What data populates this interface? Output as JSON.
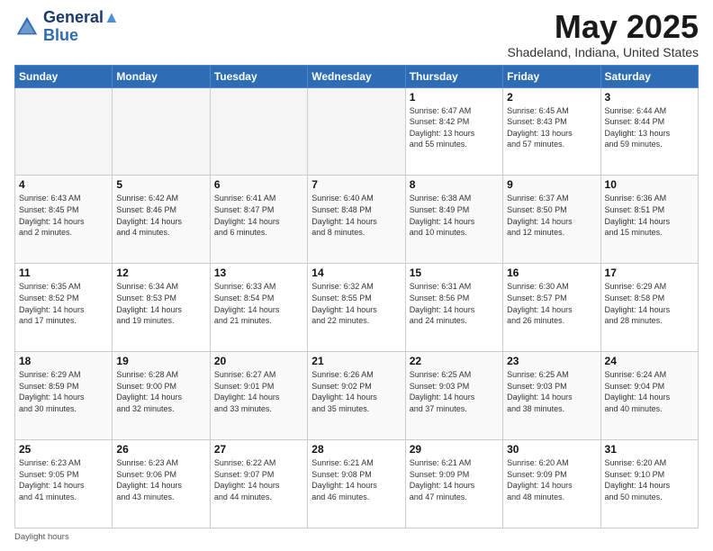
{
  "header": {
    "logo_line1": "General",
    "logo_line2": "Blue",
    "main_title": "May 2025",
    "subtitle": "Shadeland, Indiana, United States"
  },
  "calendar": {
    "headers": [
      "Sunday",
      "Monday",
      "Tuesday",
      "Wednesday",
      "Thursday",
      "Friday",
      "Saturday"
    ],
    "weeks": [
      [
        {
          "day": "",
          "info": ""
        },
        {
          "day": "",
          "info": ""
        },
        {
          "day": "",
          "info": ""
        },
        {
          "day": "",
          "info": ""
        },
        {
          "day": "1",
          "info": "Sunrise: 6:47 AM\nSunset: 8:42 PM\nDaylight: 13 hours\nand 55 minutes."
        },
        {
          "day": "2",
          "info": "Sunrise: 6:45 AM\nSunset: 8:43 PM\nDaylight: 13 hours\nand 57 minutes."
        },
        {
          "day": "3",
          "info": "Sunrise: 6:44 AM\nSunset: 8:44 PM\nDaylight: 13 hours\nand 59 minutes."
        }
      ],
      [
        {
          "day": "4",
          "info": "Sunrise: 6:43 AM\nSunset: 8:45 PM\nDaylight: 14 hours\nand 2 minutes."
        },
        {
          "day": "5",
          "info": "Sunrise: 6:42 AM\nSunset: 8:46 PM\nDaylight: 14 hours\nand 4 minutes."
        },
        {
          "day": "6",
          "info": "Sunrise: 6:41 AM\nSunset: 8:47 PM\nDaylight: 14 hours\nand 6 minutes."
        },
        {
          "day": "7",
          "info": "Sunrise: 6:40 AM\nSunset: 8:48 PM\nDaylight: 14 hours\nand 8 minutes."
        },
        {
          "day": "8",
          "info": "Sunrise: 6:38 AM\nSunset: 8:49 PM\nDaylight: 14 hours\nand 10 minutes."
        },
        {
          "day": "9",
          "info": "Sunrise: 6:37 AM\nSunset: 8:50 PM\nDaylight: 14 hours\nand 12 minutes."
        },
        {
          "day": "10",
          "info": "Sunrise: 6:36 AM\nSunset: 8:51 PM\nDaylight: 14 hours\nand 15 minutes."
        }
      ],
      [
        {
          "day": "11",
          "info": "Sunrise: 6:35 AM\nSunset: 8:52 PM\nDaylight: 14 hours\nand 17 minutes."
        },
        {
          "day": "12",
          "info": "Sunrise: 6:34 AM\nSunset: 8:53 PM\nDaylight: 14 hours\nand 19 minutes."
        },
        {
          "day": "13",
          "info": "Sunrise: 6:33 AM\nSunset: 8:54 PM\nDaylight: 14 hours\nand 21 minutes."
        },
        {
          "day": "14",
          "info": "Sunrise: 6:32 AM\nSunset: 8:55 PM\nDaylight: 14 hours\nand 22 minutes."
        },
        {
          "day": "15",
          "info": "Sunrise: 6:31 AM\nSunset: 8:56 PM\nDaylight: 14 hours\nand 24 minutes."
        },
        {
          "day": "16",
          "info": "Sunrise: 6:30 AM\nSunset: 8:57 PM\nDaylight: 14 hours\nand 26 minutes."
        },
        {
          "day": "17",
          "info": "Sunrise: 6:29 AM\nSunset: 8:58 PM\nDaylight: 14 hours\nand 28 minutes."
        }
      ],
      [
        {
          "day": "18",
          "info": "Sunrise: 6:29 AM\nSunset: 8:59 PM\nDaylight: 14 hours\nand 30 minutes."
        },
        {
          "day": "19",
          "info": "Sunrise: 6:28 AM\nSunset: 9:00 PM\nDaylight: 14 hours\nand 32 minutes."
        },
        {
          "day": "20",
          "info": "Sunrise: 6:27 AM\nSunset: 9:01 PM\nDaylight: 14 hours\nand 33 minutes."
        },
        {
          "day": "21",
          "info": "Sunrise: 6:26 AM\nSunset: 9:02 PM\nDaylight: 14 hours\nand 35 minutes."
        },
        {
          "day": "22",
          "info": "Sunrise: 6:25 AM\nSunset: 9:03 PM\nDaylight: 14 hours\nand 37 minutes."
        },
        {
          "day": "23",
          "info": "Sunrise: 6:25 AM\nSunset: 9:03 PM\nDaylight: 14 hours\nand 38 minutes."
        },
        {
          "day": "24",
          "info": "Sunrise: 6:24 AM\nSunset: 9:04 PM\nDaylight: 14 hours\nand 40 minutes."
        }
      ],
      [
        {
          "day": "25",
          "info": "Sunrise: 6:23 AM\nSunset: 9:05 PM\nDaylight: 14 hours\nand 41 minutes."
        },
        {
          "day": "26",
          "info": "Sunrise: 6:23 AM\nSunset: 9:06 PM\nDaylight: 14 hours\nand 43 minutes."
        },
        {
          "day": "27",
          "info": "Sunrise: 6:22 AM\nSunset: 9:07 PM\nDaylight: 14 hours\nand 44 minutes."
        },
        {
          "day": "28",
          "info": "Sunrise: 6:21 AM\nSunset: 9:08 PM\nDaylight: 14 hours\nand 46 minutes."
        },
        {
          "day": "29",
          "info": "Sunrise: 6:21 AM\nSunset: 9:09 PM\nDaylight: 14 hours\nand 47 minutes."
        },
        {
          "day": "30",
          "info": "Sunrise: 6:20 AM\nSunset: 9:09 PM\nDaylight: 14 hours\nand 48 minutes."
        },
        {
          "day": "31",
          "info": "Sunrise: 6:20 AM\nSunset: 9:10 PM\nDaylight: 14 hours\nand 50 minutes."
        }
      ]
    ]
  },
  "footer": {
    "text": "Daylight hours"
  }
}
